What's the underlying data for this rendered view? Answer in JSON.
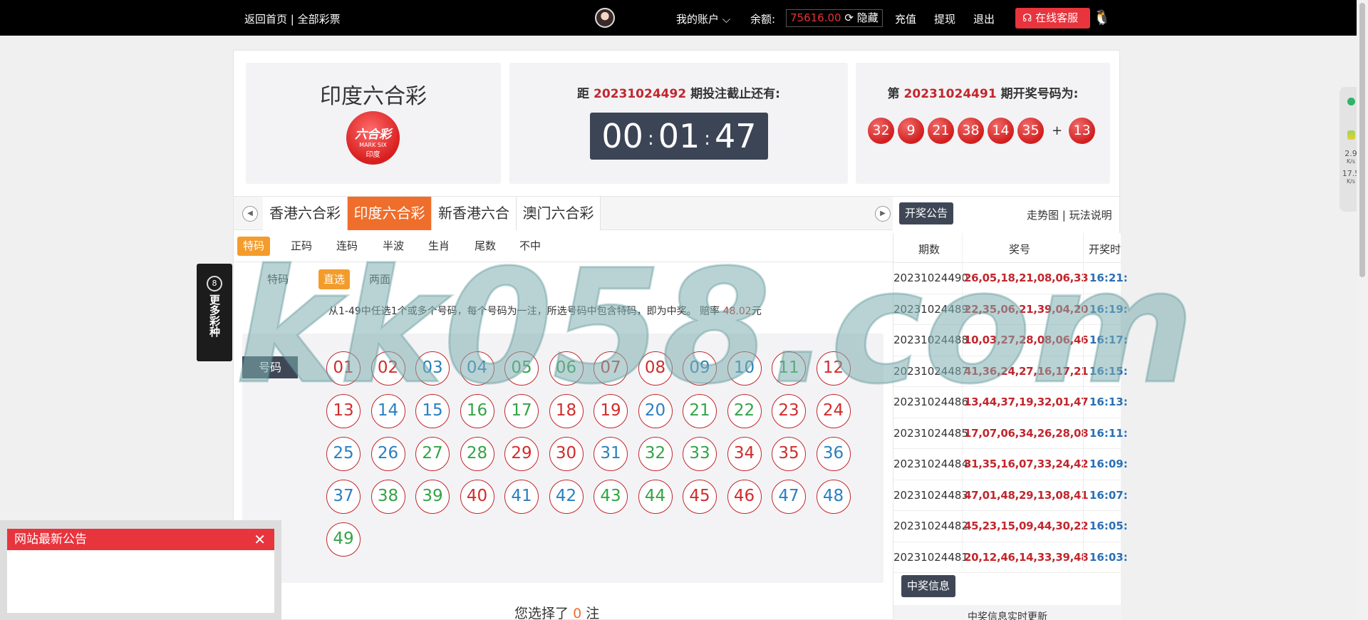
{
  "topbar": {
    "back_home": "返回首页",
    "separator": "|",
    "all_lottery": "全部彩票",
    "my_account": "我的账户",
    "balance_label": "余额:",
    "balance_value": "75616.00",
    "hide": "隐藏",
    "recharge": "充值",
    "withdraw": "提现",
    "logout": "退出",
    "online_service": "在线客服"
  },
  "header": {
    "lottery_title": "印度六合彩",
    "logo_line1": "六合彩",
    "logo_line2": "MARK SIX",
    "logo_line3": "印度",
    "countdown_prefix": "距",
    "countdown_issue": "20231024492",
    "countdown_suffix": "期投注截止还有:",
    "timer": {
      "h": "00",
      "m": "01",
      "s": "47"
    },
    "result_prefix": "第",
    "result_issue": "20231024491",
    "result_suffix": "期开奖号码为:",
    "result_balls": [
      "32",
      "9",
      "21",
      "38",
      "14",
      "35"
    ],
    "special_ball": "13"
  },
  "lottery_tabs": [
    "香港六合彩",
    "印度六合彩",
    "新香港六合",
    "澳门六合彩"
  ],
  "lottery_tab_active": 1,
  "announce_btn": "开奖公告",
  "trend_link": "走势图",
  "rules_link": "玩法说明",
  "play_tabs": [
    "特码",
    "正码",
    "连码",
    "半波",
    "生肖",
    "尾数",
    "不中"
  ],
  "sub_tabs": [
    "特码",
    "直选",
    "两面"
  ],
  "description": "从1-49中任选1个或多个号码，每个号码为一注，所选号码中包含特码，即为中奖。 赔率",
  "odds": "48.02",
  "odds_unit": "元",
  "grid_label": "号码",
  "numbers": [
    {
      "n": "01",
      "c": "red"
    },
    {
      "n": "02",
      "c": "red"
    },
    {
      "n": "03",
      "c": "blue"
    },
    {
      "n": "04",
      "c": "blue"
    },
    {
      "n": "05",
      "c": "green"
    },
    {
      "n": "06",
      "c": "green"
    },
    {
      "n": "07",
      "c": "red"
    },
    {
      "n": "08",
      "c": "red"
    },
    {
      "n": "09",
      "c": "blue"
    },
    {
      "n": "10",
      "c": "blue"
    },
    {
      "n": "11",
      "c": "green"
    },
    {
      "n": "12",
      "c": "red"
    },
    {
      "n": "13",
      "c": "red"
    },
    {
      "n": "14",
      "c": "blue"
    },
    {
      "n": "15",
      "c": "blue"
    },
    {
      "n": "16",
      "c": "green"
    },
    {
      "n": "17",
      "c": "green"
    },
    {
      "n": "18",
      "c": "red"
    },
    {
      "n": "19",
      "c": "red"
    },
    {
      "n": "20",
      "c": "blue"
    },
    {
      "n": "21",
      "c": "green"
    },
    {
      "n": "22",
      "c": "green"
    },
    {
      "n": "23",
      "c": "red"
    },
    {
      "n": "24",
      "c": "red"
    },
    {
      "n": "25",
      "c": "blue"
    },
    {
      "n": "26",
      "c": "blue"
    },
    {
      "n": "27",
      "c": "green"
    },
    {
      "n": "28",
      "c": "green"
    },
    {
      "n": "29",
      "c": "red"
    },
    {
      "n": "30",
      "c": "red"
    },
    {
      "n": "31",
      "c": "blue"
    },
    {
      "n": "32",
      "c": "green"
    },
    {
      "n": "33",
      "c": "green"
    },
    {
      "n": "34",
      "c": "red"
    },
    {
      "n": "35",
      "c": "red"
    },
    {
      "n": "36",
      "c": "blue"
    },
    {
      "n": "37",
      "c": "blue"
    },
    {
      "n": "38",
      "c": "green"
    },
    {
      "n": "39",
      "c": "green"
    },
    {
      "n": "40",
      "c": "red"
    },
    {
      "n": "41",
      "c": "blue"
    },
    {
      "n": "42",
      "c": "blue"
    },
    {
      "n": "43",
      "c": "green"
    },
    {
      "n": "44",
      "c": "green"
    },
    {
      "n": "45",
      "c": "red"
    },
    {
      "n": "46",
      "c": "red"
    },
    {
      "n": "47",
      "c": "blue"
    },
    {
      "n": "48",
      "c": "blue"
    },
    {
      "n": "49",
      "c": "green"
    }
  ],
  "selection_summary": {
    "prefix": "您选择了",
    "count": "0",
    "suffix": "注"
  },
  "results_table": {
    "headers": [
      "期数",
      "奖号",
      "开奖时"
    ],
    "rows": [
      {
        "issue": "20231024490",
        "nums": "26,05,18,21,08,06,33",
        "time": "16:21:"
      },
      {
        "issue": "20231024489",
        "nums": "22,35,06,21,39,04,20",
        "time": "16:19:"
      },
      {
        "issue": "20231024488",
        "nums": "10,03,27,28,08,06,46",
        "time": "16:17:"
      },
      {
        "issue": "20231024487",
        "nums": "41,36,24,27,16,17,21",
        "time": "16:15:"
      },
      {
        "issue": "20231024486",
        "nums": "13,44,37,19,32,01,47",
        "time": "16:13:"
      },
      {
        "issue": "20231024485",
        "nums": "17,07,06,34,26,28,08",
        "time": "16:11:"
      },
      {
        "issue": "20231024484",
        "nums": "31,35,16,07,33,24,42",
        "time": "16:09:"
      },
      {
        "issue": "20231024483",
        "nums": "47,01,48,29,13,08,41",
        "time": "16:07:"
      },
      {
        "issue": "20231024482",
        "nums": "45,23,15,09,44,30,22",
        "time": "16:05:"
      },
      {
        "issue": "20231024481",
        "nums": "20,12,46,14,33,39,48",
        "time": "16:03:"
      }
    ]
  },
  "winner_info_btn": "中奖信息",
  "winner_info_text": "中奖信息实时更新",
  "more_tab": {
    "icon_text": "8",
    "label": "更多彩种"
  },
  "notice": {
    "title": "网站最新公告",
    "close": "✕"
  },
  "speed": {
    "up": "2.9",
    "up_unit": "K/s",
    "down": "17.5",
    "down_unit": "K/s"
  },
  "watermark": "kk058.com",
  "colors": {
    "red": "#d12c2c",
    "blue": "#2a7fc1",
    "green": "#34a346",
    "accent_orange": "#ef6e2c",
    "dark": "#3f4757"
  }
}
